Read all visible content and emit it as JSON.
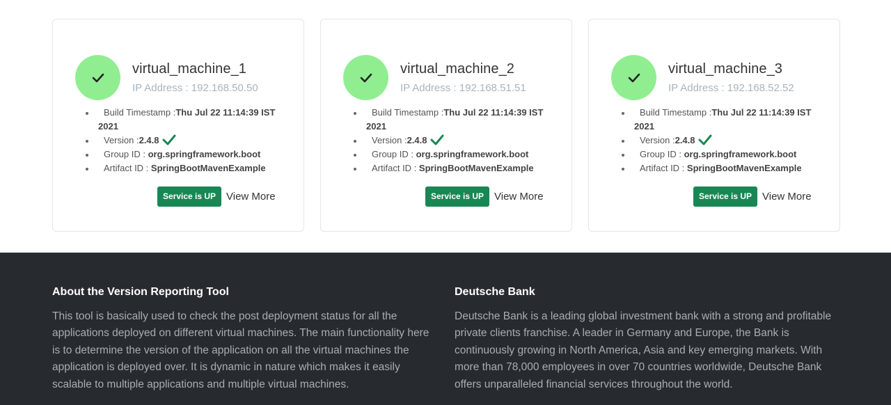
{
  "cards": [
    {
      "name": "virtual_machine_1",
      "ip": "IP Address : 192.168.50.50",
      "build_label": "Build Timestamp :",
      "build_value": "Thu Jul 22 11:14:39 IST",
      "build_value_wrap": "2021",
      "version_label": "Version :",
      "version_value": "2.4.8",
      "group_label": "Group ID :",
      "group_value": "org.springframework.boot",
      "artifact_label": "Artifact ID :",
      "artifact_value": "SpringBootMavenExample",
      "status": "Service is UP",
      "view_more": "View More"
    },
    {
      "name": "virtual_machine_2",
      "ip": "IP Address : 192.168.51.51",
      "build_label": "Build Timestamp :",
      "build_value": "Thu Jul 22 11:14:39 IST",
      "build_value_wrap": "2021",
      "version_label": "Version :",
      "version_value": "2.4.8",
      "group_label": "Group ID :",
      "group_value": "org.springframework.boot",
      "artifact_label": "Artifact ID :",
      "artifact_value": "SpringBootMavenExample",
      "status": "Service is UP",
      "view_more": "View More"
    },
    {
      "name": "virtual_machine_3",
      "ip": "IP Address : 192.168.52.52",
      "build_label": "Build Timestamp :",
      "build_value": "Thu Jul 22 11:14:39 IST",
      "build_value_wrap": "2021",
      "version_label": "Version :",
      "version_value": "2.4.8",
      "group_label": "Group ID :",
      "group_value": "org.springframework.boot",
      "artifact_label": "Artifact ID :",
      "artifact_value": "SpringBootMavenExample",
      "status": "Service is UP",
      "view_more": "View More"
    }
  ],
  "footer": {
    "about_title": "About the Version Reporting Tool",
    "about_text": "This tool is basically used to check the post deployment status for all the applications deployed on different virtual machines. The main functionality here is to determine the version of the application on all the virtual machines the application is deployed over. It is dynamic in nature which makes it easily scalable to multiple applications and multiple virtual machines.",
    "bank_title": "Deutsche Bank",
    "bank_text": "Deutsche Bank is a leading global investment bank with a strong and profitable private clients franchise. A leader in Germany and Europe, the Bank is continuously growing in North America, Asia and key emerging markets. With more than 78,000 employees in over 70 countries worldwide, Deutsche Bank offers unparalleled financial services throughout the world."
  },
  "icons": {
    "status": "check-icon",
    "version": "check-icon"
  },
  "colors": {
    "status_circle": "#90ee90",
    "badge": "#198754",
    "version_check": "#198754",
    "footer_bg": "#272b30"
  }
}
